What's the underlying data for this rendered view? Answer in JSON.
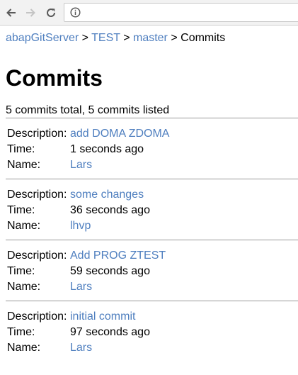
{
  "browser": {
    "back_icon": "arrow-left-icon",
    "forward_icon": "arrow-right-icon",
    "reload_icon": "reload-icon",
    "info_icon": "info-icon",
    "address": ""
  },
  "breadcrumb": [
    {
      "label": "abapGitServer",
      "link": true
    },
    {
      "label": "TEST",
      "link": true
    },
    {
      "label": "master",
      "link": true
    },
    {
      "label": "Commits",
      "link": false
    }
  ],
  "breadcrumb_separator": ">",
  "page": {
    "title": "Commits",
    "summary": "5 commits total, 5 commits listed"
  },
  "labels": {
    "description": "Description:",
    "time": "Time:",
    "name": "Name:"
  },
  "commits": [
    {
      "description": "add DOMA ZDOMA",
      "time": "1 seconds ago",
      "name": "Lars"
    },
    {
      "description": "some changes",
      "time": "36 seconds ago",
      "name": "lhvp"
    },
    {
      "description": "Add PROG ZTEST",
      "time": "59 seconds ago",
      "name": "Lars"
    },
    {
      "description": "initial commit",
      "time": "97 seconds ago",
      "name": "Lars"
    }
  ],
  "colors": {
    "link": "#4f7fbf",
    "divider": "#9a9a9a",
    "toolbar": "#f2f2f2"
  }
}
